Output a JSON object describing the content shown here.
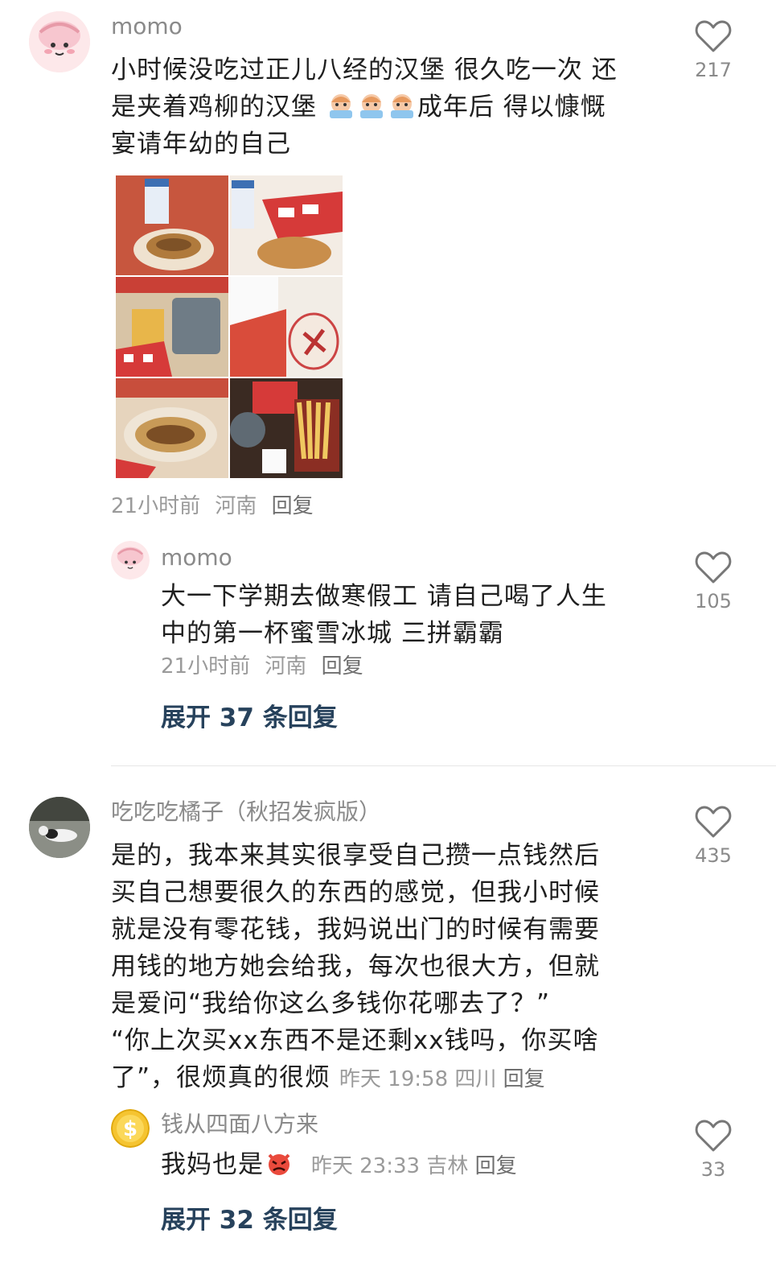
{
  "comments": [
    {
      "author": "momo",
      "text_line1": "小时候没吃过正儿八经的汉堡 很久吃一次 还",
      "text_line2_a": "是夹着鸡柳的汉堡 ",
      "text_line2_b": "成年后 得以慷慨",
      "text_line3": "宴请年幼的自己",
      "emoji": "crying-face-emoji",
      "meta": {
        "time": "21小时前",
        "location": "河南",
        "reply": "回复"
      },
      "likes": "217",
      "photos": [
        "burger-photo",
        "burger-photo",
        "fries-and-drink-photo",
        "fried-chicken-photo",
        "burger-photo",
        "fries-photo"
      ],
      "reply": {
        "author": "momo",
        "text_line1": "大一下学期去做寒假工 请自己喝了人生",
        "text_line2": "中的第一杯蜜雪冰城 三拼霸霸",
        "meta": {
          "time": "21小时前",
          "location": "河南",
          "reply": "回复"
        },
        "likes": "105"
      },
      "expand": "展开 37 条回复"
    },
    {
      "author": "吃吃吃橘子（秋招发疯版）",
      "text_lines": [
        "是的，我本来其实很享受自己攒一点钱然后",
        "买自己想要很久的东西的感觉，但我小时候",
        "就是没有零花钱，我妈说出门的时候有需要",
        "用钱的地方她会给我，每次也很大方，但就",
        "是爱问“我给你这么多钱你花哪去了？”",
        "“你上次买xx东西不是还剩xx钱吗，你买啥"
      ],
      "text_last": "了”，很烦真的很烦",
      "meta": {
        "time": "昨天 19:58",
        "location": "四川",
        "reply": "回复"
      },
      "likes": "435",
      "reply": {
        "author": "钱从四面八方来",
        "text": "我妈也是",
        "emoji": "angry-devil-emoji",
        "meta": {
          "time": "昨天 23:33",
          "location": "吉林",
          "reply": "回复"
        },
        "likes": "33"
      },
      "expand": "展开 32 条回复"
    }
  ],
  "colors": {
    "expand": "#27425c",
    "meta": "#9a9a9a",
    "name": "#8a8a8a"
  }
}
